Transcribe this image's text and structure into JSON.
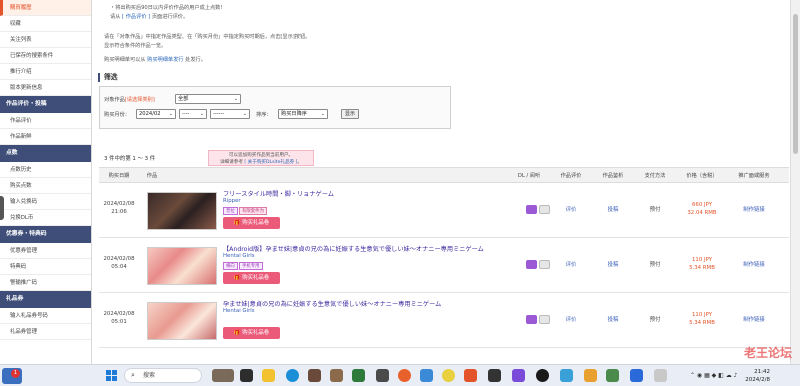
{
  "sidebar": {
    "items_top": [
      "購買履歴",
      "収藏",
      "关注列表",
      "已保存的搜索条件",
      "推行介绍",
      "版本更新信息"
    ],
    "section_reviews": "作品评价・投稿",
    "items_reviews": [
      "作品评价",
      "作品新鲜"
    ],
    "section_points": "点数",
    "items_points": [
      "点数历史",
      "购买点数",
      "输入兑换码",
      "兑换DL币"
    ],
    "section_coupons": "优惠券・特典码",
    "items_coupons": [
      "优惠券管理",
      "特典码",
      "警输推广码"
    ],
    "section_gift": "礼品券",
    "items_gift": [
      "输入礼品券号码",
      "礼品券管理"
    ]
  },
  "notes": {
    "line1": "・将出购买后90日以内评价作品的用户成上点数!",
    "line2_prefix": "请从",
    "line2_link": "[ 作品评价 ]",
    "line2_suffix": "页面进行评价。",
    "line3": "请在「对象作品」中指定作品类型、在「购买月份」中指定购买时期后，点击[显示]按钮。",
    "line4": "显示符合条件的作品一览。",
    "line5_prefix": "购买明细单可以从",
    "line5_link": "购买明细单发行",
    "line5_suffix": "处发行。"
  },
  "filter": {
    "title": "筛选",
    "label_target": "对象作品",
    "label_target_required": "[请选择类别]",
    "target_value": "全部",
    "label_month": "购买月份：",
    "year_month": "2024/02",
    "day_value": "----",
    "day2_value": "------",
    "label_sort": "排序：",
    "sort_value": "购买日降序",
    "show_button": "显示"
  },
  "result_count": "3 件中的第 1 ～ 3 件",
  "tip": {
    "line1": "可以追加购买作品到当前用户。",
    "line2_prefix": "详细请参考 ",
    "line2_link": "[ 关于购买DLsite礼品券 ]",
    "line2_suffix": "。"
  },
  "table": {
    "headers": {
      "date": "购买日期",
      "work": "作品",
      "dl": "DL / 阅听",
      "review": "作品评价",
      "report": "作品鉴析",
      "payment": "支付方法",
      "price": "价格（含税）",
      "service": "推广面或服务"
    },
    "rows": [
      {
        "date": "2024/02/08",
        "time": "21:06",
        "title": "フリースタイル時間・脚・リョナゲーム",
        "circle": "Ripper",
        "tags": [
          "普拉",
          "有限套件为"
        ],
        "gift_button": "购买礼品卷",
        "review": "评价",
        "report": "投稿",
        "payment": "预付",
        "price_jpy": "660 JPY",
        "price_rmb": "32.04 RMB",
        "service": "制作链接"
      },
      {
        "date": "2024/02/08",
        "time": "05:04",
        "title": "【Android版】孕ませ妹|意貞の兄の為に妊娠する生意気で優しい妹～オナニー専用ミニゲーム",
        "circle": "Hentai Girls",
        "tags": [
          "横向",
          "手机专用"
        ],
        "gift_button": "购买礼品卷",
        "review": "评价",
        "report": "投稿",
        "payment": "预付",
        "price_jpy": "110 JPY",
        "price_rmb": "5.34 RMB",
        "service": "制作链接"
      },
      {
        "date": "2024/02/08",
        "time": "05:01",
        "title": "孕ませ妹|意貞の兄の為に妊娠する生意気で優しい妹～オナニー専用ミニゲーム",
        "circle": "Hentai Girls",
        "tags": [],
        "gift_button": "购买礼品卷",
        "review": "评价",
        "report": "投稿",
        "payment": "预付",
        "price_jpy": "110 JPY",
        "price_rmb": "5.34 RMB",
        "service": "制作链接"
      }
    ]
  },
  "watermark": "老王论坛",
  "taskbar": {
    "badge": "1",
    "search_placeholder": "搜索",
    "time": "21:42",
    "date": "2024/2/8"
  },
  "colors": {
    "accent": "#e4542b",
    "sidebar_head": "#3e4e78",
    "gift_button": "#ec5a7a",
    "link": "#3a5fb8"
  }
}
